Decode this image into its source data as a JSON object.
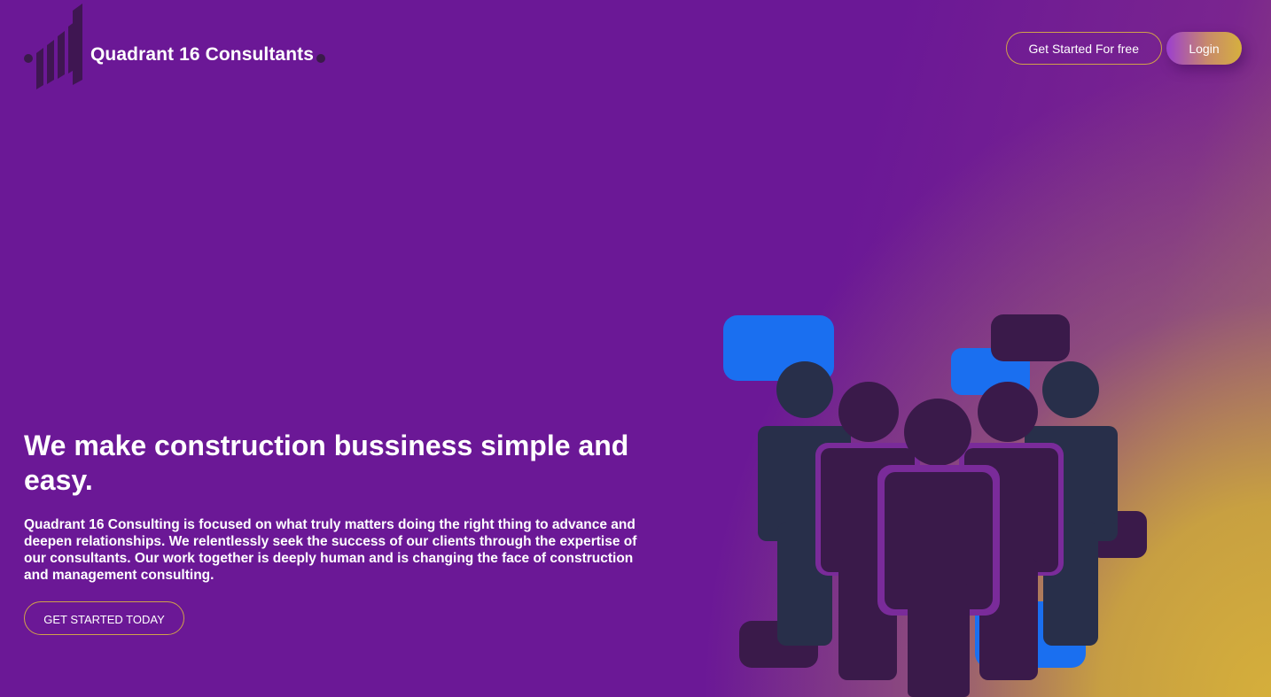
{
  "header": {
    "brand_name": "Quadrant 16 Consultants",
    "nav": {
      "get_started_label": "Get Started For free",
      "login_label": "Login"
    }
  },
  "hero": {
    "title": "We make construction bussiness simple and easy.",
    "description": "Quadrant 16 Consulting is focused on what truly matters doing the right thing to advance and deepen relationships. We relentlessly seek the success of our clients through the expertise of our consultants. Our work together is deeply human and is changing the face of construction and management consulting.",
    "cta_label": "GET STARTED TODAY"
  },
  "colors": {
    "background": "#6b1896",
    "accent_gold": "#d6b03e",
    "outline_border": "#d0a24a",
    "bubble_blue": "#1a6ff0",
    "figure_dark": "#3a1a4a",
    "figure_navy": "#282f4a"
  },
  "icons": {
    "logo": "bar-chart-logo-icon",
    "illustration": "team-people-speech-bubbles-illustration"
  }
}
